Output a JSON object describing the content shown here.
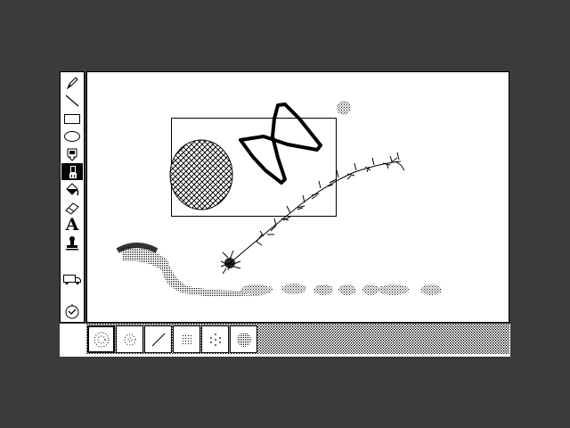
{
  "app": {
    "tools": [
      {
        "id": "pencil",
        "icon": "pencil-icon"
      },
      {
        "id": "line",
        "icon": "line-icon"
      },
      {
        "id": "rectangle",
        "icon": "rectangle-icon"
      },
      {
        "id": "oval",
        "icon": "oval-icon"
      },
      {
        "id": "spray",
        "icon": "spray-can-icon"
      },
      {
        "id": "brush",
        "icon": "brush-icon",
        "selected": true
      },
      {
        "id": "fill",
        "icon": "paint-bucket-icon"
      },
      {
        "id": "eraser",
        "icon": "eraser-icon"
      },
      {
        "id": "text",
        "icon": "text-tool-icon",
        "label": "A"
      },
      {
        "id": "stamp",
        "icon": "stamp-icon"
      },
      {
        "id": "truck",
        "icon": "truck-icon"
      },
      {
        "id": "undo",
        "icon": "undo-bomb-icon"
      }
    ],
    "brushes": [
      {
        "id": "brush-1",
        "icon": "dotted-brush-icon",
        "selected": true
      },
      {
        "id": "brush-2",
        "icon": "dotted-brush-icon"
      },
      {
        "id": "brush-3",
        "icon": "slash-brush-icon"
      },
      {
        "id": "brush-4",
        "icon": "grid-brush-icon"
      },
      {
        "id": "brush-5",
        "icon": "sparse-brush-icon"
      },
      {
        "id": "brush-6",
        "icon": "dense-brush-icon"
      }
    ],
    "colors": {
      "background": "#3b3b3b",
      "ink": "#000000",
      "paper": "#ffffff"
    }
  }
}
